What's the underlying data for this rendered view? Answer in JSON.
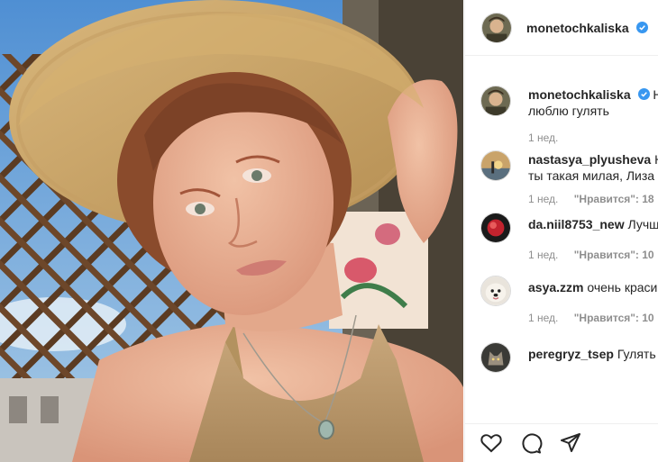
{
  "post": {
    "author": "monetochkaliska",
    "verified": true,
    "photo_alt": "selfie-in-straw-hat"
  },
  "caption": {
    "user": "monetochkaliska",
    "text_line1": "Н",
    "text_line2": "люблю гулять",
    "time": "1 нед."
  },
  "comments": [
    {
      "user": "nastasya_plyusheva",
      "text_line1": "Н",
      "text_line2": "ты такая милая, Лиза",
      "time": "1 нед.",
      "likes": "\"Нравится\": 18",
      "avatar": "sunset-avatar"
    },
    {
      "user": "da.niil8753_new",
      "text_line1": "Лучш",
      "text_line2": "",
      "time": "1 нед.",
      "likes": "\"Нравится\": 10",
      "avatar": "red-avatar"
    },
    {
      "user": "asya.zzm",
      "text_line1": "очень краси",
      "text_line2": "",
      "time": "1 нед.",
      "likes": "\"Нравится\": 10",
      "avatar": "dog-avatar"
    },
    {
      "user": "peregryz_tsep",
      "text_line1": "Гулять",
      "text_line2": "",
      "time": "",
      "likes": "",
      "avatar": "wolf-avatar"
    }
  ],
  "actions": {
    "like_icon": "heart-icon",
    "comment_icon": "comment-icon",
    "share_icon": "paper-plane-icon"
  },
  "colors": {
    "verified": "#3897f0",
    "meta_text": "#8e8e8e",
    "text": "#262626"
  }
}
